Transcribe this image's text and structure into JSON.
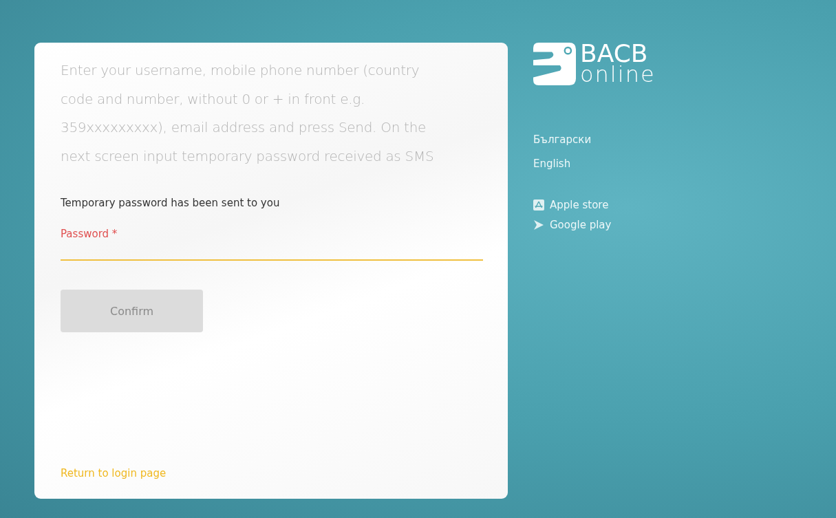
{
  "card": {
    "instructions": "Enter your username, mobile phone number (country code and number, without 0 or + in front e.g. 359xxxxxxxxx), email address and press Send. On the next screen input temporary password received as SMS",
    "notice": "Temporary password has been sent to you",
    "password_field": {
      "label": "Password *",
      "focused": true
    },
    "confirm_button": {
      "label": "Confirm",
      "disabled": true
    },
    "return_link": "Return to login page"
  },
  "logo": {
    "title": "BACB",
    "subtitle": "online"
  },
  "languages": [
    {
      "label": "Български"
    },
    {
      "label": "English"
    }
  ],
  "stores": [
    {
      "kind": "apple",
      "label": "Apple store"
    },
    {
      "kind": "google",
      "label": "Google play"
    }
  ]
}
